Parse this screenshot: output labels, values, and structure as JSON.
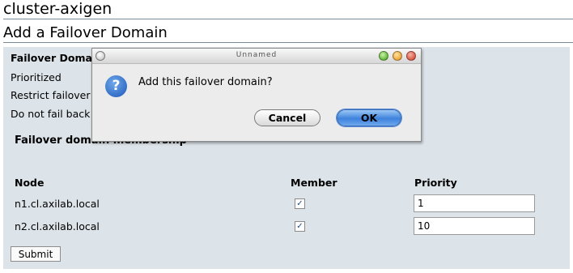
{
  "page": {
    "cluster_title": "cluster-axigen",
    "heading": "Add a Failover Domain"
  },
  "form": {
    "failover_domain_label": "Failover Domai",
    "prioritized_label": "Prioritized",
    "restrict_label": "Restrict failover",
    "no_failback_label": "Do not fail back",
    "membership_heading": "Failover domain membership",
    "columns": {
      "node": "Node",
      "member": "Member",
      "priority": "Priority"
    },
    "rows": [
      {
        "node": "n1.cl.axilab.local",
        "member_checked": true,
        "priority": "1"
      },
      {
        "node": "n2.cl.axilab.local",
        "member_checked": true,
        "priority": "10"
      }
    ],
    "submit_label": "Submit"
  },
  "dialog": {
    "title": "Unnamed",
    "icon": "question-icon",
    "message": "Add this failover domain?",
    "cancel_label": "Cancel",
    "ok_label": "OK"
  },
  "colors": {
    "panel_background": "#dce3e9",
    "ok_button_blue": "#3d82dc"
  }
}
